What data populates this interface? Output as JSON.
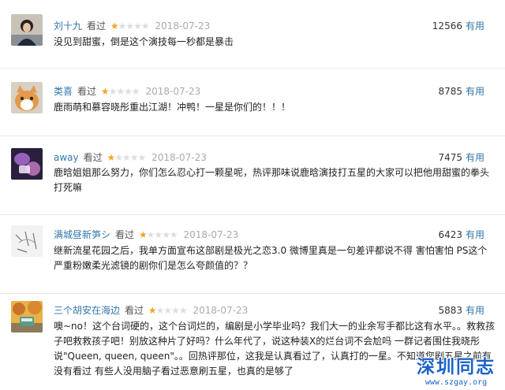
{
  "reviews": [
    {
      "username": "刘十九",
      "seen_label": "看过",
      "rating": 1,
      "date": "2018-07-23",
      "votes": "12566",
      "useful_label": "有用",
      "text": "没见到甜蜜，倒是这个演技每一秒都是暴击",
      "avatar": "woman-photo"
    },
    {
      "username": "类喜",
      "seen_label": "看过",
      "rating": 1,
      "date": "2018-07-23",
      "votes": "8785",
      "useful_label": "有用",
      "text": "鹿雨萌和慕容晓彤重出江湖！冲鸭！一星是你们的！！！",
      "avatar": "cat-photo"
    },
    {
      "username": "away",
      "seen_label": "看过",
      "rating": 1,
      "date": "2018-07-23",
      "votes": "7475",
      "useful_label": "有用",
      "text": "鹿晗姐姐那么努力，你们怎么忍心打一颗星呢，热评那味说鹿晗演技打五星的大家可以把他用甜蜜的拳头打死嘛",
      "avatar": "purple-light-photo"
    },
    {
      "username": "满城昼新笋シ",
      "seen_label": "看过",
      "rating": 1,
      "date": "2018-07-23",
      "votes": "6423",
      "useful_label": "有用",
      "text": "继新流星花园之后，我单方面宣布这部剧是极光之恋3.0 微博里真是一句差评都说不得 害怕害怕 PS这个严重粉嫩柔光滤镜的剧你们是怎么夸颜值的？？",
      "avatar": "sketch-avatar"
    },
    {
      "username": "三个胡安在海边",
      "seen_label": "看过",
      "rating": 1,
      "date": "2018-07-23",
      "votes": "5883",
      "useful_label": "有用",
      "text": "噢~no！这个台词硬的，这个台词烂的，编剧是小学毕业吗？我们大一的业余写手都比这有水平。。救救孩子吧救救孩子吧！别放这种片了好吗？什么年代了，说这种装X的烂台词不会尬吗 一群记者围住我晓彤说\"Queen, queen, queen\"。。回热评那位，这我是认真看过了，认真打的一星。不知道您剧五星之前有没有看过 有些人没用脑子看过恶意刷五星，也真的是够了",
      "avatar": "autumn-bus-photo"
    }
  ],
  "watermark": {
    "title": "深圳同志",
    "url": "www.szgay.org"
  }
}
